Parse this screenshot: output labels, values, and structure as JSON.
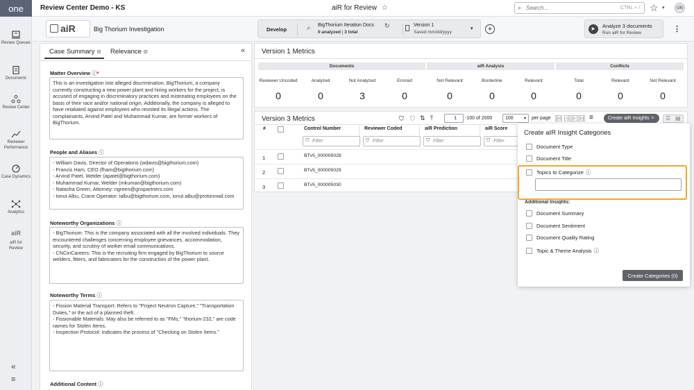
{
  "nav": {
    "logo": "one",
    "items": [
      {
        "label": "Review Queues",
        "icon": "review-queues-icon"
      },
      {
        "label": "Documents",
        "icon": "documents-icon"
      },
      {
        "label": "Review Center",
        "icon": "review-center-icon"
      },
      {
        "label": "Reviewer Performance",
        "icon": "reviewer-performance-icon"
      },
      {
        "label": "Case Dynamics",
        "icon": "case-dynamics-icon"
      },
      {
        "label": "Analytics",
        "icon": "analytics-icon"
      },
      {
        "label": "aiR for Review",
        "icon": "air-icon"
      }
    ]
  },
  "topbar": {
    "app_title": "Review Center Demo - KS",
    "center_title": "aiR for Review",
    "search_placeholder": "Search...",
    "search_shortcut": "CTRL + /",
    "avatar": "UN"
  },
  "secbar": {
    "air_logo": "aiR",
    "project_name": "Big Thorium Investigation",
    "mode": "Develop",
    "docset_name": "BigThorium Iteration Docs",
    "docset_analyzed": "0 analyzed",
    "docset_total": "3 total",
    "version_name": "Version 1",
    "version_saved": "Saved mm/dd/yyyy",
    "analyze_title": "Analyze 3 documents",
    "analyze_sub": "Run aiR for Review"
  },
  "left": {
    "tab_case_summary": "Case Summary",
    "tab_relevance": "Relevance",
    "matter_label": "Matter Overview",
    "matter_text": "This is an investigation into alleged discrimination. BigThorium, a company currently constructing a new power plant and hiring workers for the project, is accused of engaging in discriminatory practices and mistreating employees on the basis of their race and/or national origin. Additionally, the company is alleged to have retaliated against employees who resisted its illegal actions. The complainants, Arvind Patel and Muhammad Kumar, are former workers of BigThorium.",
    "people_label": "People and Aliases",
    "people_text": "- William Davis, Director of Operations (wdavis@bigthorium.com)\n- Francis Ham, CEO (fham@bigthorium.com)\n- Arvind Patel, Welder (apatel@bigthorium.com)\n- Muhammad Kumar, Welder (mkuman@bigthorium.com)\n- Natasha Green, Attorney: ngreen@gnspartners.com\n- Ionut Albu, Crane Operator: ialbu@bigthorium.com, ionut.albu@protonmail.com",
    "orgs_label": "Noteworthy Organizations",
    "orgs_text": "- BigThorium: This is the company associated with all the involved individuals. They encountered challenges concerning employee grievances, accommodation, security, and scrutiny of worker email communications.\n- CNCinCareers: This is the recruiting firm engaged by BigThorium to source welders, fitters, and fabricators for the construction of the power plant.",
    "terms_label": "Noteworthy Terms",
    "terms_text": "- Fission Material Transport: Refers to \"Project Neutron Capture,\" \"Transportation Duties,\" or the act of a planned theft.\n- Fissionable Materials: May also be referred to as \"FMs,\" \"thorium-232,\" are code names for Stolen Items.\n- Inspection Protocol: Indicates the process of \"Checking on Stolen Items.\"",
    "additional_label": "Additional Content"
  },
  "v1": {
    "title": "Version 1 Metrics",
    "groups": [
      "Documents",
      "aiR Analysis",
      "Conflicts"
    ],
    "metrics": [
      {
        "label": "Reviewer Uncoded",
        "value": "0"
      },
      {
        "label": "Analyzed",
        "value": "0"
      },
      {
        "label": "Not Analyzed",
        "value": "3"
      },
      {
        "label": "Errored",
        "value": "0"
      },
      {
        "label": "Not Relevant",
        "value": "0"
      },
      {
        "label": "Borderline",
        "value": "0"
      },
      {
        "label": "Relevant",
        "value": "0"
      },
      {
        "label": "Total",
        "value": "0"
      },
      {
        "label": "Relevant",
        "value": "0"
      },
      {
        "label": "Not Relevant",
        "value": "0"
      }
    ]
  },
  "v3": {
    "title": "Version 3 Metrics",
    "page_value": "1",
    "page_range": "-100 of 2000",
    "per_page_value": "100",
    "per_page_label": "per page",
    "create_insights": "Create aiR Insights",
    "columns": [
      "#",
      "Control Number",
      "Reviewer Coded",
      "aiR Prediction",
      "aiR Score"
    ],
    "filter_placeholder": "Filter",
    "rows": [
      {
        "num": "1",
        "control": "BTv5_000005028"
      },
      {
        "num": "2",
        "control": "BTv5_000005029"
      },
      {
        "num": "3",
        "control": "BTv5_000005030"
      }
    ]
  },
  "popup": {
    "title": "Create aIR Insight Categories",
    "items": [
      "Document Type",
      "Document Title"
    ],
    "topics_label": "Topics to Categorize",
    "additional_label": "Additional Insights:",
    "additional_items": [
      "Document Summary",
      "Document Sentiment",
      "Document Quality Rating",
      "Topic & Theme Analysis"
    ],
    "create_button": "Create Categories (0)"
  },
  "colors": {
    "highlight": "#f5a623",
    "nav_bg": "#eceef1",
    "logo_bg": "#5b6475"
  }
}
